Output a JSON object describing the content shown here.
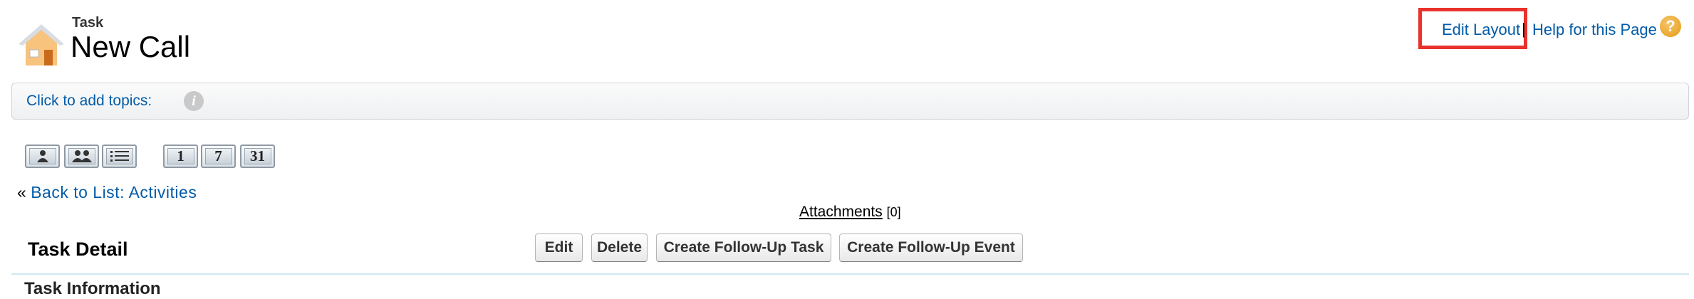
{
  "header": {
    "object_type": "Task",
    "title": "New Call",
    "edit_layout_label": "Edit Layout",
    "separator": "|",
    "help_label": "Help for this Page",
    "help_icon_glyph": "?"
  },
  "topics": {
    "label": "Click to add topics:",
    "info_glyph": "i"
  },
  "view_buttons": [
    {
      "name": "single-user-icon"
    },
    {
      "name": "multi-user-icon"
    },
    {
      "name": "list-view-icon"
    },
    {
      "label": "1"
    },
    {
      "label": "7"
    },
    {
      "label": "31"
    }
  ],
  "navigation": {
    "back_prefix": "«",
    "back_label": "Back to List: Activities"
  },
  "attachments": {
    "label": "Attachments",
    "count": "[0]"
  },
  "detail": {
    "title": "Task Detail",
    "buttons": {
      "edit": "Edit",
      "delete": "Delete",
      "follow_up_task": "Create Follow-Up Task",
      "follow_up_event": "Create Follow-Up Event"
    },
    "section_cut": "Task Information"
  },
  "colors": {
    "link": "#015ba7",
    "highlight": "#e8322b",
    "help_icon": "#e39a17"
  }
}
